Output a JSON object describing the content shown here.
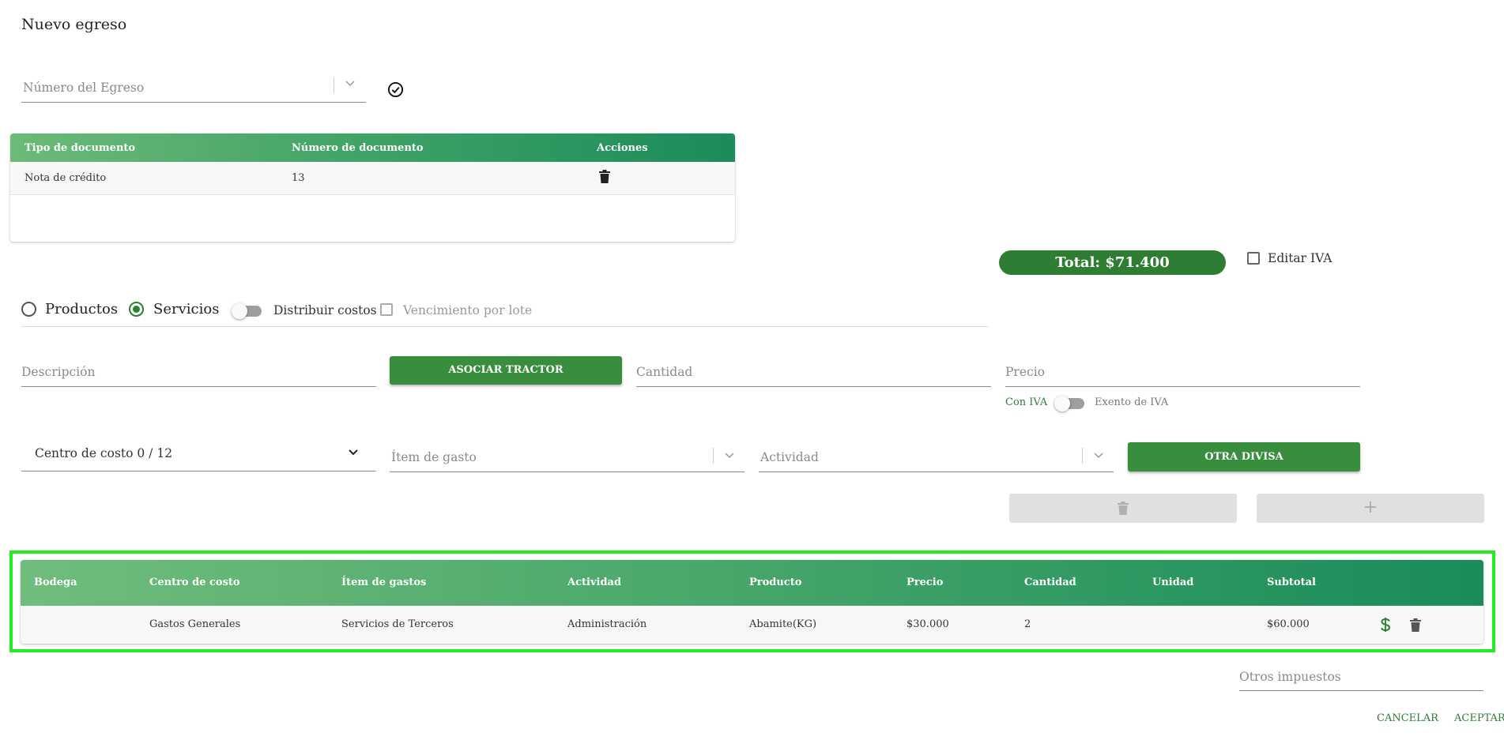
{
  "page": {
    "title": "Nuevo egreso"
  },
  "egreso": {
    "placeholder": "Número del Egreso"
  },
  "documents": {
    "headers": [
      "Tipo de documento",
      "Número de documento",
      "Acciones"
    ],
    "rows": [
      {
        "tipo": "Nota de crédito",
        "numero": "13"
      }
    ]
  },
  "total": {
    "label": "Total: $71.400"
  },
  "editar_iva": {
    "label": "Editar IVA",
    "checked": false
  },
  "mode": {
    "productos_label": "Productos",
    "servicios_label": "Servicios",
    "selected": "Servicios",
    "distribuir_label": "Distribuir costos",
    "vencimiento_label": "Vencimiento por lote"
  },
  "form": {
    "descripcion_placeholder": "Descripción",
    "asociar_button": "ASOCIAR TRACTOR",
    "cantidad_placeholder": "Cantidad",
    "precio_placeholder": "Precio",
    "con_iva_label": "Con IVA",
    "exento_label": "Exento de IVA",
    "centro_costo_value": "Centro de costo 0 / 12",
    "item_gasto_placeholder": "Ítem de gasto",
    "actividad_placeholder": "Actividad",
    "otra_divisa_button": "OTRA DIVISA",
    "add_symbol": "+"
  },
  "items": {
    "headers": [
      "Bodega",
      "Centro de costo",
      "Ítem de gastos",
      "Actividad",
      "Producto",
      "Precio",
      "Cantidad",
      "Unidad",
      "Subtotal"
    ],
    "rows": [
      {
        "bodega": "",
        "centro": "Gastos Generales",
        "item": "Servicios de Terceros",
        "actividad": "Administración",
        "producto": "Abamite(KG)",
        "precio": "$30.000",
        "cantidad": "2",
        "unidad": "",
        "subtotal": "$60.000"
      }
    ]
  },
  "otros_impuestos": {
    "placeholder": "Otros impuestos"
  },
  "footer": {
    "cancel": "CANCELAR",
    "accept": "ACEPTAR"
  },
  "colors": {
    "accent": "#2e7d32",
    "highlight": "#22ee22"
  }
}
